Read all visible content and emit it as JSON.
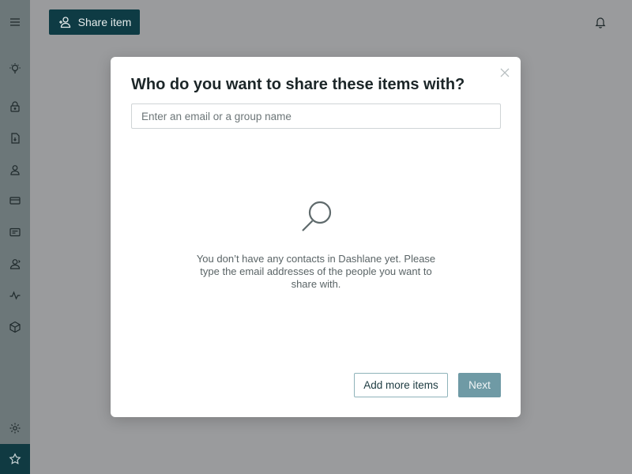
{
  "topbar": {
    "share_button_label": "Share item"
  },
  "sidebar": {
    "items": [
      {
        "icon": "menu-icon"
      },
      {
        "icon": "lightbulb-icon"
      },
      {
        "icon": "lock-icon"
      },
      {
        "icon": "secure-note-icon"
      },
      {
        "icon": "person-icon"
      },
      {
        "icon": "credit-card-icon"
      },
      {
        "icon": "id-card-icon"
      },
      {
        "icon": "sharing-icon"
      },
      {
        "icon": "activity-icon"
      },
      {
        "icon": "cube-icon"
      },
      {
        "icon": "gear-icon"
      },
      {
        "icon": "star-icon"
      }
    ]
  },
  "modal": {
    "title": "Who do you want to share these items with?",
    "search_placeholder": "Enter an email or a group name",
    "empty_message": "You don’t have any contacts in Dashlane yet. Please type the email addresses of the people you want to share with.",
    "add_more_label": "Add more items",
    "next_label": "Next"
  },
  "colors": {
    "overlay_bg": "#9a9b9d",
    "sidebar_bg": "#6c7779",
    "accent_dark": "#0e3b44",
    "next_button": "#6f9aa5",
    "modal_bg": "#ffffff"
  }
}
